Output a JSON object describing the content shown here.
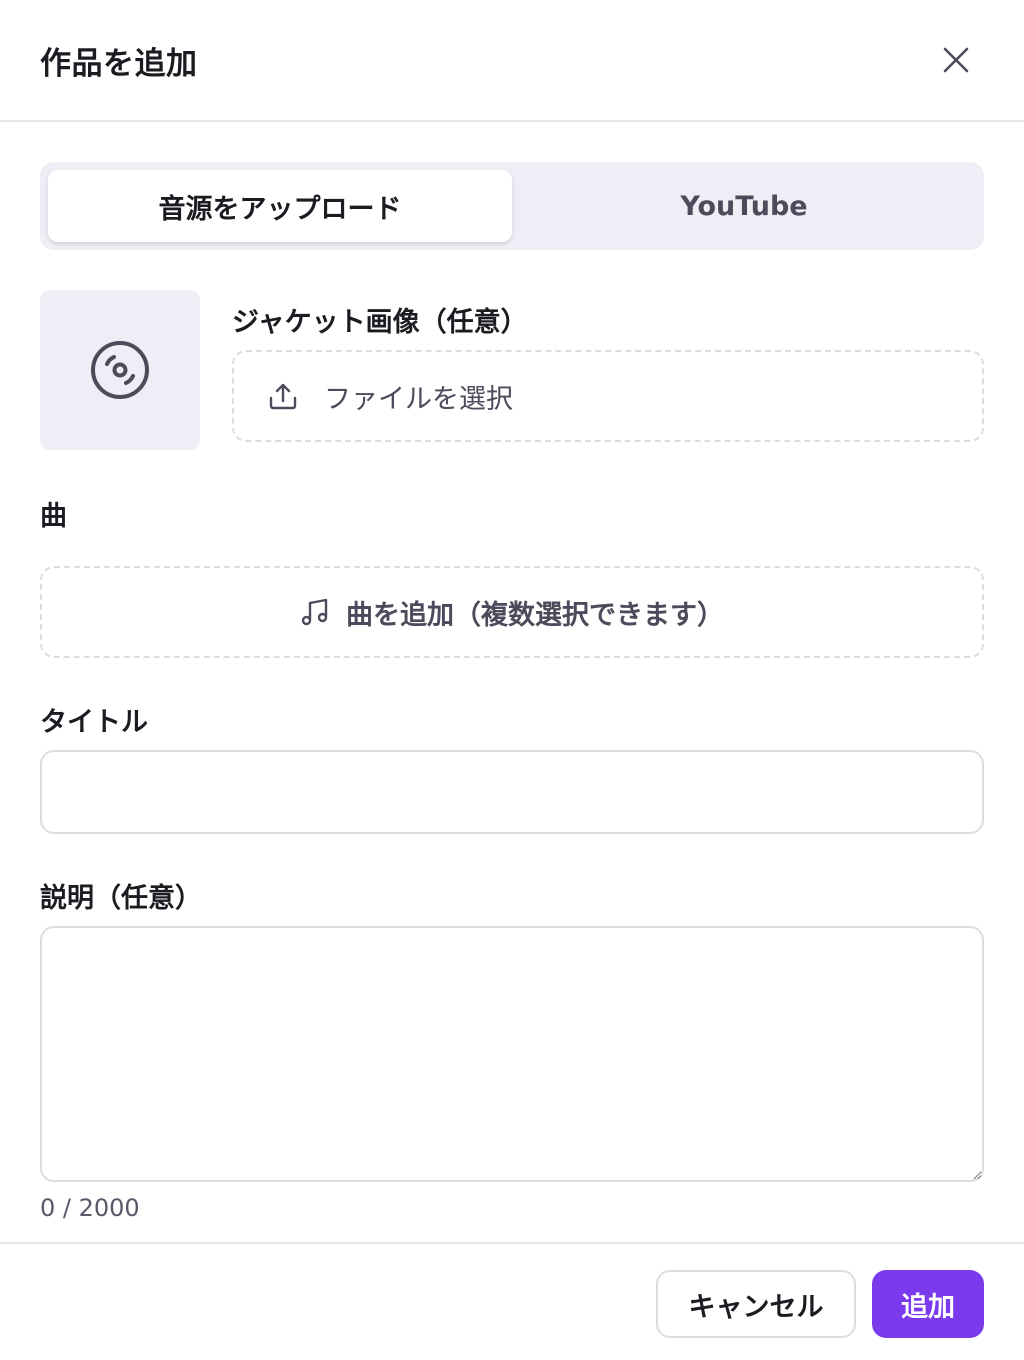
{
  "dialog": {
    "title": "作品を追加",
    "close_icon": "close-icon"
  },
  "tabs": [
    {
      "label": "音源をアップロード",
      "selected": true
    },
    {
      "label": "YouTube",
      "selected": false
    }
  ],
  "jacket": {
    "label": "ジャケット画像（任意）",
    "placeholder_icon": "disc-icon",
    "file_button_icon": "upload-icon",
    "file_button_label": "ファイルを選択"
  },
  "songs": {
    "label": "曲",
    "add_icon": "music-note-icon",
    "add_label": "曲を追加（複数選択できます）"
  },
  "title_field": {
    "label": "タイトル",
    "value": ""
  },
  "description_field": {
    "label": "説明（任意）",
    "value": "",
    "counter": "0 / 2000"
  },
  "actions": {
    "cancel_label": "キャンセル",
    "submit_label": "追加"
  },
  "colors": {
    "accent": "#7c3aed",
    "tab_track": "#efeef6",
    "border": "#dcdbe3",
    "text": "#1c1b22",
    "muted_text": "#4d4a5c"
  }
}
